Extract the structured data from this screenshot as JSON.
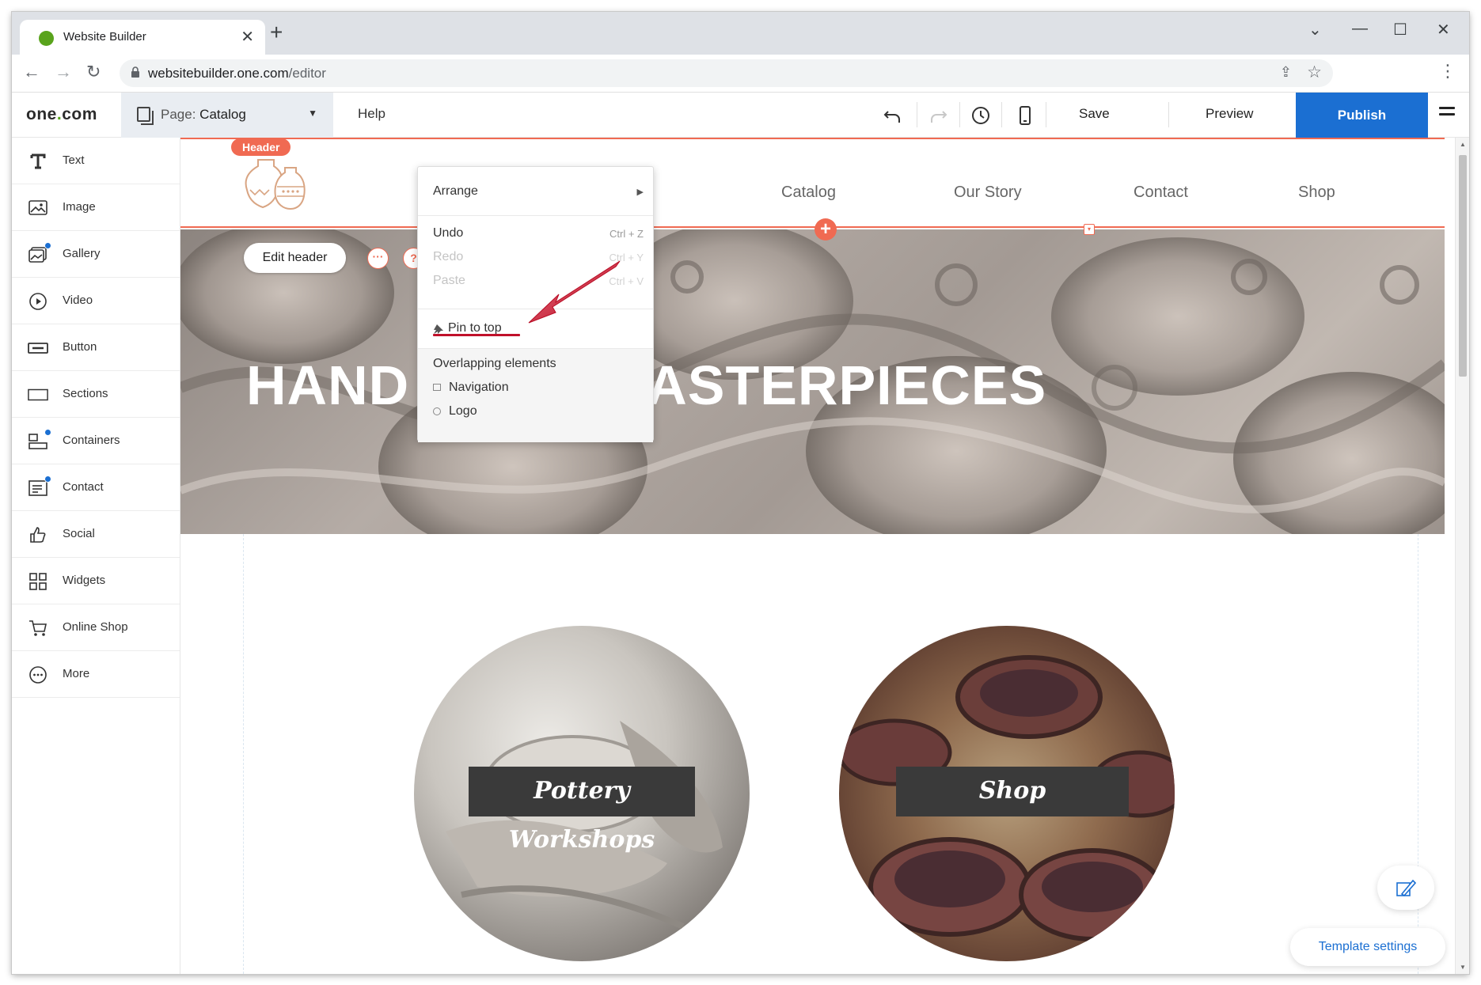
{
  "browser": {
    "tab_title": "Website Builder",
    "url_host": "websitebuilder.one.com",
    "url_path": "/editor"
  },
  "toolbar": {
    "logo_main": "one",
    "logo_dot": ".",
    "logo_tail": "com",
    "page_prefix": "Page:",
    "page_name": "Catalog",
    "help": "Help",
    "save": "Save",
    "preview": "Preview",
    "publish": "Publish"
  },
  "sidebar": {
    "items": [
      {
        "label": "Text",
        "icon": "text-icon"
      },
      {
        "label": "Image",
        "icon": "image-icon"
      },
      {
        "label": "Gallery",
        "icon": "gallery-icon"
      },
      {
        "label": "Video",
        "icon": "video-icon"
      },
      {
        "label": "Button",
        "icon": "button-icon"
      },
      {
        "label": "Sections",
        "icon": "sections-icon"
      },
      {
        "label": "Containers",
        "icon": "containers-icon"
      },
      {
        "label": "Contact",
        "icon": "contact-icon"
      },
      {
        "label": "Social",
        "icon": "social-icon"
      },
      {
        "label": "Widgets",
        "icon": "widgets-icon"
      },
      {
        "label": "Online Shop",
        "icon": "cart-icon"
      },
      {
        "label": "More",
        "icon": "more-icon"
      }
    ]
  },
  "canvas": {
    "header_tag": "Header",
    "nav": [
      "Catalog",
      "Our Story",
      "Contact",
      "Shop"
    ],
    "edit_header": "Edit header",
    "more_dots": "···",
    "help_mark": "?",
    "hero_left": "HAND",
    "hero_right": "ASTERPIECES",
    "card_1": "Pottery Workshops",
    "card_2": "Shop",
    "template_settings": "Template settings"
  },
  "context_menu": {
    "arrange": "Arrange",
    "undo": "Undo",
    "undo_shortcut": "Ctrl + Z",
    "redo": "Redo",
    "redo_shortcut": "Ctrl + Y",
    "paste": "Paste",
    "paste_shortcut": "Ctrl + V",
    "pin": "Pin to top",
    "overlap_title": "Overlapping elements",
    "overlap_items": [
      "Navigation",
      "Logo"
    ]
  },
  "colors": {
    "accent": "#f06a52",
    "publish": "#1b6fd2",
    "annotation": "#c0102a"
  }
}
